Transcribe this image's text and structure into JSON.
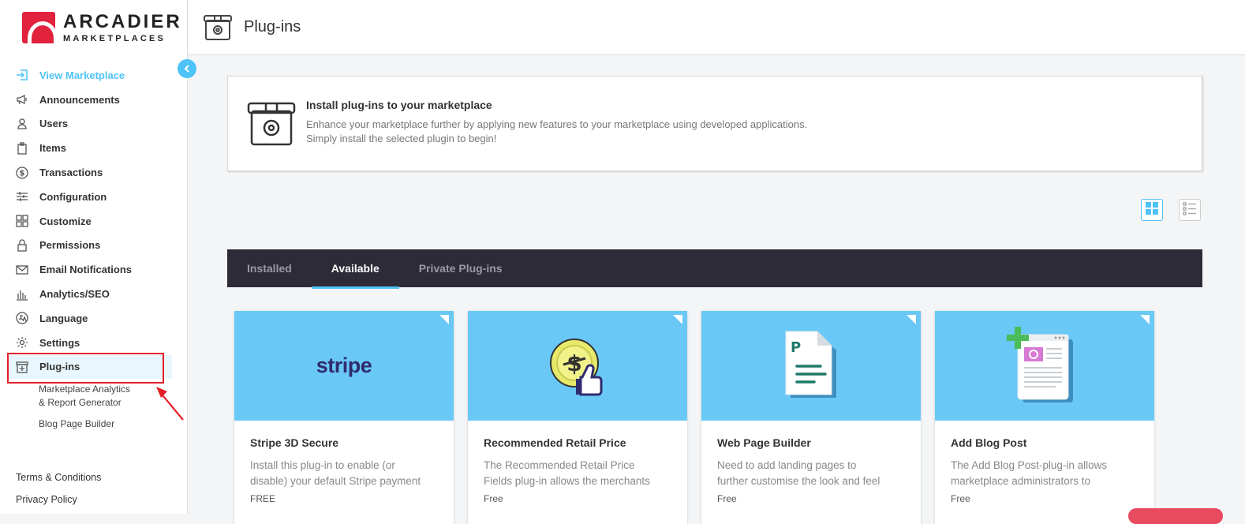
{
  "brand": {
    "line1": "ARCADIER",
    "line2": "MARKETPLACES"
  },
  "page": {
    "title": "Plug-ins"
  },
  "sidebar": {
    "collapse_icon": "chevron-left-icon",
    "items": [
      {
        "label": "View Marketplace",
        "icon": "enter-icon",
        "active": true
      },
      {
        "label": "Announcements",
        "icon": "megaphone-icon"
      },
      {
        "label": "Users",
        "icon": "user-icon"
      },
      {
        "label": "Items",
        "icon": "clipboard-icon"
      },
      {
        "label": "Transactions",
        "icon": "dollar-icon"
      },
      {
        "label": "Configuration",
        "icon": "sliders-icon"
      },
      {
        "label": "Customize",
        "icon": "grid-icon"
      },
      {
        "label": "Permissions",
        "icon": "lock-icon"
      },
      {
        "label": "Email Notifications",
        "icon": "mail-icon"
      },
      {
        "label": "Analytics/SEO",
        "icon": "bar-chart-icon"
      },
      {
        "label": "Language",
        "icon": "translate-icon"
      },
      {
        "label": "Settings",
        "icon": "gear-icon"
      },
      {
        "label": "Plug-ins",
        "icon": "plugin-box-icon"
      }
    ],
    "sub_items": [
      {
        "line1": "Marketplace Analytics",
        "line2": "& Report Generator"
      },
      {
        "line1": "Blog Page Builder",
        "line2": ""
      }
    ],
    "footer": {
      "terms": "Terms & Conditions",
      "privacy": "Privacy Policy"
    }
  },
  "intro": {
    "heading": "Install plug-ins to your marketplace",
    "line1": "Enhance your marketplace further by applying new features to your marketplace using developed applications.",
    "line2": "Simply install the selected plugin to begin!"
  },
  "tabs": [
    {
      "label": "Installed"
    },
    {
      "label": "Available",
      "active": true
    },
    {
      "label": "Private Plug-ins"
    }
  ],
  "cards": [
    {
      "title": "Stripe 3D Secure",
      "desc1": "Install this plug-in to enable (or",
      "desc2": "disable) your default Stripe payment",
      "price": "FREE",
      "logo_text": "stripe"
    },
    {
      "title": "Recommended Retail Price",
      "desc1": "The Recommended Retail Price",
      "desc2": "Fields plug-in allows the merchants",
      "price": "Free"
    },
    {
      "title": "Web Page Builder",
      "desc1": "Need to add landing pages to",
      "desc2": "further customise the look and feel",
      "price": "Free",
      "page_letter": "P"
    },
    {
      "title": "Add Blog Post",
      "desc1": "The Add Blog Post-plug-in allows",
      "desc2": "marketplace administrators to",
      "price": "Free"
    }
  ],
  "colors": {
    "accent": "#4fc3f7",
    "tab_bar": "#2e2b38",
    "card_header": "#6ac8f7",
    "highlight": "#e3202a",
    "brand_red": "#e0223d"
  }
}
